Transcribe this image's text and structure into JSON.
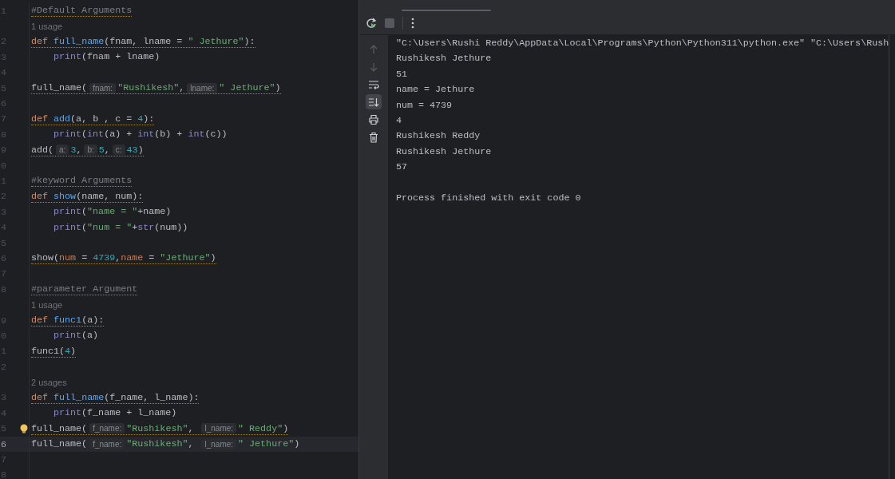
{
  "editor": {
    "lines": [
      {
        "kind": "code",
        "number": "1",
        "current": false,
        "warning": true,
        "indent": false,
        "tokens": [
          {
            "kind": "c",
            "text": "#Default Arguments"
          }
        ]
      },
      {
        "kind": "usage",
        "text": "1 usage"
      },
      {
        "kind": "code",
        "number": "2",
        "current": false,
        "warning": true,
        "indent": false,
        "tokens": [
          {
            "kind": "k",
            "text": "def"
          },
          {
            "kind": "f",
            "text": " full_name"
          },
          {
            "kind": "p",
            "text": "(fnam, lname = "
          },
          {
            "kind": "s",
            "text": "\" Jethure\""
          },
          {
            "kind": "p",
            "text": "):"
          }
        ]
      },
      {
        "kind": "code",
        "number": "3",
        "current": false,
        "warning": false,
        "indent": true,
        "tokens": [
          {
            "kind": "b",
            "text": "print"
          },
          {
            "kind": "p",
            "text": "(fnam + lname)"
          }
        ]
      },
      {
        "kind": "code",
        "number": "4",
        "current": false
      },
      {
        "kind": "code",
        "number": "5",
        "current": false,
        "warning": true,
        "indent": false,
        "tokens": [
          {
            "kind": "p",
            "text": "full_name("
          },
          {
            "kind": "h",
            "text": "fnam:"
          },
          {
            "kind": "s",
            "text": "\"Rushikesh\""
          },
          {
            "kind": "p",
            "text": ","
          },
          {
            "kind": "h",
            "text": "lname:"
          },
          {
            "kind": "s",
            "text": "\" Jethure\""
          },
          {
            "kind": "p",
            "text": ")"
          }
        ]
      },
      {
        "kind": "code",
        "number": "6",
        "current": false
      },
      {
        "kind": "code",
        "number": "7",
        "current": false,
        "warning": true,
        "indent": false,
        "tokens": [
          {
            "kind": "k",
            "text": "def"
          },
          {
            "kind": "f",
            "text": " add"
          },
          {
            "kind": "p",
            "text": "(a, b , c = "
          },
          {
            "kind": "n",
            "text": "4"
          },
          {
            "kind": "p",
            "text": "):"
          }
        ]
      },
      {
        "kind": "code",
        "number": "8",
        "current": false,
        "warning": false,
        "indent": true,
        "tokens": [
          {
            "kind": "b",
            "text": "print"
          },
          {
            "kind": "p",
            "text": "("
          },
          {
            "kind": "b",
            "text": "int"
          },
          {
            "kind": "p",
            "text": "(a) + "
          },
          {
            "kind": "b",
            "text": "int"
          },
          {
            "kind": "p",
            "text": "(b) + "
          },
          {
            "kind": "b",
            "text": "int"
          },
          {
            "kind": "p",
            "text": "(c))"
          }
        ]
      },
      {
        "kind": "code",
        "number": "9",
        "current": false,
        "warning": true,
        "indent": false,
        "tokens": [
          {
            "kind": "p",
            "text": "add("
          },
          {
            "kind": "h",
            "text": "a:"
          },
          {
            "kind": "n",
            "text": "3"
          },
          {
            "kind": "p",
            "text": ","
          },
          {
            "kind": "h",
            "text": "b:"
          },
          {
            "kind": "n",
            "text": "5"
          },
          {
            "kind": "p",
            "text": ","
          },
          {
            "kind": "h",
            "text": "c:"
          },
          {
            "kind": "n",
            "text": "43"
          },
          {
            "kind": "p",
            "text": ")"
          }
        ]
      },
      {
        "kind": "code",
        "number": "0",
        "current": false
      },
      {
        "kind": "code",
        "number": "1",
        "current": false,
        "warning": true,
        "indent": false,
        "tokens": [
          {
            "kind": "c",
            "text": "#keyword Arguments"
          }
        ]
      },
      {
        "kind": "code",
        "number": "2",
        "current": false,
        "warning": true,
        "indent": false,
        "tokens": [
          {
            "kind": "k",
            "text": "def"
          },
          {
            "kind": "f",
            "text": " show"
          },
          {
            "kind": "p",
            "text": "(name, num):"
          }
        ]
      },
      {
        "kind": "code",
        "number": "3",
        "current": false,
        "warning": false,
        "indent": true,
        "tokens": [
          {
            "kind": "b",
            "text": "print"
          },
          {
            "kind": "p",
            "text": "("
          },
          {
            "kind": "s",
            "text": "\"name = \""
          },
          {
            "kind": "p",
            "text": "+name)"
          }
        ]
      },
      {
        "kind": "code",
        "number": "4",
        "current": false,
        "warning": false,
        "indent": true,
        "tokens": [
          {
            "kind": "b",
            "text": "print"
          },
          {
            "kind": "p",
            "text": "("
          },
          {
            "kind": "s",
            "text": "\"num = \""
          },
          {
            "kind": "p",
            "text": "+"
          },
          {
            "kind": "b",
            "text": "str"
          },
          {
            "kind": "p",
            "text": "(num))"
          }
        ]
      },
      {
        "kind": "code",
        "number": "5",
        "current": false
      },
      {
        "kind": "code",
        "number": "6",
        "current": false,
        "warning": true,
        "indent": false,
        "tokens": [
          {
            "kind": "p",
            "text": "show("
          },
          {
            "kind": "a",
            "text": "num"
          },
          {
            "kind": "p",
            "text": " = "
          },
          {
            "kind": "n",
            "text": "4739"
          },
          {
            "kind": "p",
            "text": ","
          },
          {
            "kind": "a",
            "text": "name"
          },
          {
            "kind": "p",
            "text": " = "
          },
          {
            "kind": "s",
            "text": "\"Jethure\""
          },
          {
            "kind": "p",
            "text": ")"
          }
        ]
      },
      {
        "kind": "code",
        "number": "7",
        "current": false
      },
      {
        "kind": "code",
        "number": "8",
        "current": false,
        "warning": true,
        "indent": false,
        "tokens": [
          {
            "kind": "c",
            "text": "#parameter Argument"
          }
        ]
      },
      {
        "kind": "usage",
        "text": "1 usage"
      },
      {
        "kind": "code",
        "number": "9",
        "current": false,
        "warning": true,
        "indent": false,
        "tokens": [
          {
            "kind": "k",
            "text": "def"
          },
          {
            "kind": "f",
            "text": " func1"
          },
          {
            "kind": "p",
            "text": "(a):"
          }
        ]
      },
      {
        "kind": "code",
        "number": "0",
        "current": false,
        "warning": false,
        "indent": true,
        "tokens": [
          {
            "kind": "b",
            "text": "print"
          },
          {
            "kind": "p",
            "text": "(a)"
          }
        ]
      },
      {
        "kind": "code",
        "number": "1",
        "current": false,
        "warning": true,
        "indent": false,
        "tokens": [
          {
            "kind": "p",
            "text": "func1("
          },
          {
            "kind": "n",
            "text": "4"
          },
          {
            "kind": "p",
            "text": ")"
          }
        ]
      },
      {
        "kind": "code",
        "number": "2",
        "current": false
      },
      {
        "kind": "usage",
        "text": "2 usages"
      },
      {
        "kind": "code",
        "number": "3",
        "current": false,
        "warning": true,
        "indent": false,
        "tokens": [
          {
            "kind": "k",
            "text": "def"
          },
          {
            "kind": "f",
            "text": " full_name"
          },
          {
            "kind": "p",
            "text": "(f_name, l_name):"
          }
        ]
      },
      {
        "kind": "code",
        "number": "4",
        "current": false,
        "warning": false,
        "indent": true,
        "tokens": [
          {
            "kind": "b",
            "text": "print"
          },
          {
            "kind": "p",
            "text": "(f_name + l_name)"
          }
        ]
      },
      {
        "kind": "code",
        "number": "5",
        "current": false,
        "warning": true,
        "bulb": true,
        "indent": false,
        "tokens": [
          {
            "kind": "p",
            "text": "full_name("
          },
          {
            "kind": "h",
            "text": "f_name:"
          },
          {
            "kind": "s",
            "text": "\"Rushikesh\""
          },
          {
            "kind": "p",
            "text": ", "
          },
          {
            "kind": "h",
            "text": "l_name:"
          },
          {
            "kind": "s",
            "text": "\" Reddy\""
          },
          {
            "kind": "p",
            "text": ")"
          }
        ]
      },
      {
        "kind": "code",
        "number": "6",
        "current": true,
        "warning": false,
        "indent": false,
        "tokens": [
          {
            "kind": "p",
            "text": "full_name("
          },
          {
            "kind": "h",
            "text": "f_name:"
          },
          {
            "kind": "s",
            "text": "\"Rushikesh\""
          },
          {
            "kind": "p",
            "text": ", "
          },
          {
            "kind": "h",
            "text": "l_name:"
          },
          {
            "kind": "s",
            "text": "\" Jethure\""
          },
          {
            "kind": "p",
            "text": ")"
          }
        ]
      },
      {
        "kind": "code",
        "number": "7",
        "current": false
      },
      {
        "kind": "code",
        "number": "8",
        "current": false
      }
    ]
  },
  "run_panel": {
    "toolbar": [
      {
        "kind": "rerun",
        "disabled": false
      },
      {
        "kind": "stop",
        "disabled": true
      },
      {
        "kind": "more",
        "disabled": false
      }
    ],
    "side_tools": [
      {
        "kind": "up",
        "disabled": true,
        "selected": false
      },
      {
        "kind": "down",
        "disabled": true,
        "selected": false
      },
      {
        "kind": "wrap",
        "disabled": false,
        "selected": false
      },
      {
        "kind": "scroll-end",
        "disabled": false,
        "selected": true
      },
      {
        "kind": "print",
        "disabled": false,
        "selected": false
      },
      {
        "kind": "trash",
        "disabled": false,
        "selected": false
      }
    ],
    "output": [
      "\"C:\\Users\\Rushi Reddy\\AppData\\Local\\Programs\\Python\\Python311\\python.exe\" \"C:\\Users\\Rush",
      "Rushikesh Jethure",
      "51",
      "name = Jethure",
      "num = 4739",
      "4",
      "Rushikesh Reddy",
      "Rushikesh Jethure",
      "57"
    ],
    "exit_message": "Process finished with exit code 0"
  }
}
